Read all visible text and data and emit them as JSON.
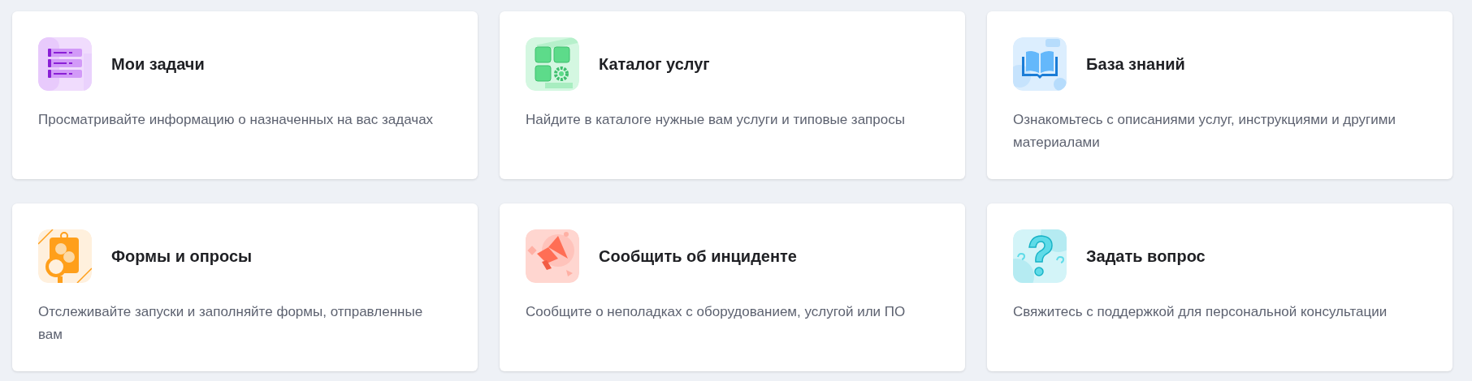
{
  "cards": [
    {
      "kind": "tasks",
      "title": "Мои задачи",
      "description": "Просматривайте информацию о назначенных на вас задачах"
    },
    {
      "kind": "catalog",
      "title": "Каталог услуг",
      "description": "Найдите в каталоге нужные вам услуги и типовые запросы"
    },
    {
      "kind": "knowledge",
      "title": "База знаний",
      "description": "Ознакомьтесь с описаниями услуг, инструкциями и другими материалами"
    },
    {
      "kind": "forms",
      "title": "Формы и опросы",
      "description": "Отслеживайте запуски и заполняйте формы, отправленные вам"
    },
    {
      "kind": "incident",
      "title": "Сообщить об инциденте",
      "description": "Сообщите о неполадках с оборудованием, услугой или ПО"
    },
    {
      "kind": "question",
      "title": "Задать вопрос",
      "description": "Свяжитесь с поддержкой для персональной консультации"
    }
  ]
}
